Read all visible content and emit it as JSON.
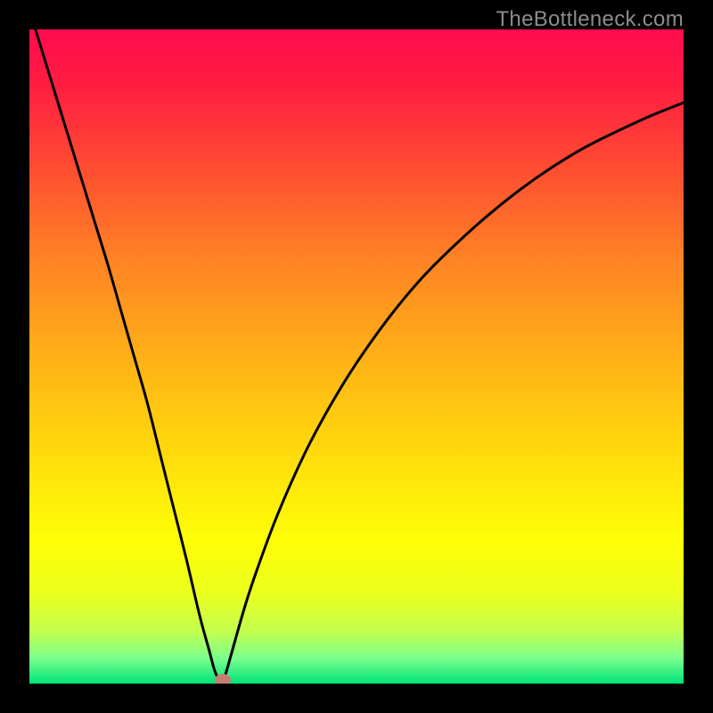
{
  "chart_data": {
    "type": "line",
    "title": "",
    "xlabel": "",
    "ylabel": "",
    "xlim": [
      0,
      100
    ],
    "ylim": [
      0,
      100
    ],
    "series": [
      {
        "name": "bottleneck-curve",
        "x": [
          0,
          2,
          4,
          6,
          8,
          10,
          12,
          14,
          16,
          18,
          20,
          22,
          24,
          26,
          27.5,
          28.5,
          29.5,
          30,
          31,
          33,
          35,
          38,
          42,
          46,
          50,
          55,
          60,
          65,
          70,
          75,
          80,
          85,
          90,
          95,
          100
        ],
        "values": [
          103,
          96.5,
          90,
          83.5,
          77,
          70.5,
          64,
          57,
          50,
          43,
          35,
          27,
          19,
          10.5,
          5,
          1.5,
          0.5,
          1.5,
          5,
          12,
          18,
          26,
          35,
          42.5,
          49,
          56,
          62,
          67,
          71.5,
          75.5,
          79,
          82,
          84.5,
          86.8,
          88.8
        ]
      }
    ],
    "annotations": [
      {
        "name": "optimal-point-marker",
        "x": 29.5,
        "y": 0.5
      }
    ],
    "background": "rainbow-gradient",
    "gradient_stops": [
      {
        "pos": 0.0,
        "color": "#ff0b4e"
      },
      {
        "pos": 0.08,
        "color": "#ff1c42"
      },
      {
        "pos": 0.2,
        "color": "#ff4833"
      },
      {
        "pos": 0.35,
        "color": "#ff8224"
      },
      {
        "pos": 0.5,
        "color": "#ffb017"
      },
      {
        "pos": 0.65,
        "color": "#ffdb0c"
      },
      {
        "pos": 0.78,
        "color": "#fefe06"
      },
      {
        "pos": 0.86,
        "color": "#ecff1c"
      },
      {
        "pos": 0.92,
        "color": "#c3ff4e"
      },
      {
        "pos": 0.96,
        "color": "#7eff8c"
      },
      {
        "pos": 1.0,
        "color": "#00e47a"
      }
    ]
  },
  "watermark": "TheBottleneck.com"
}
